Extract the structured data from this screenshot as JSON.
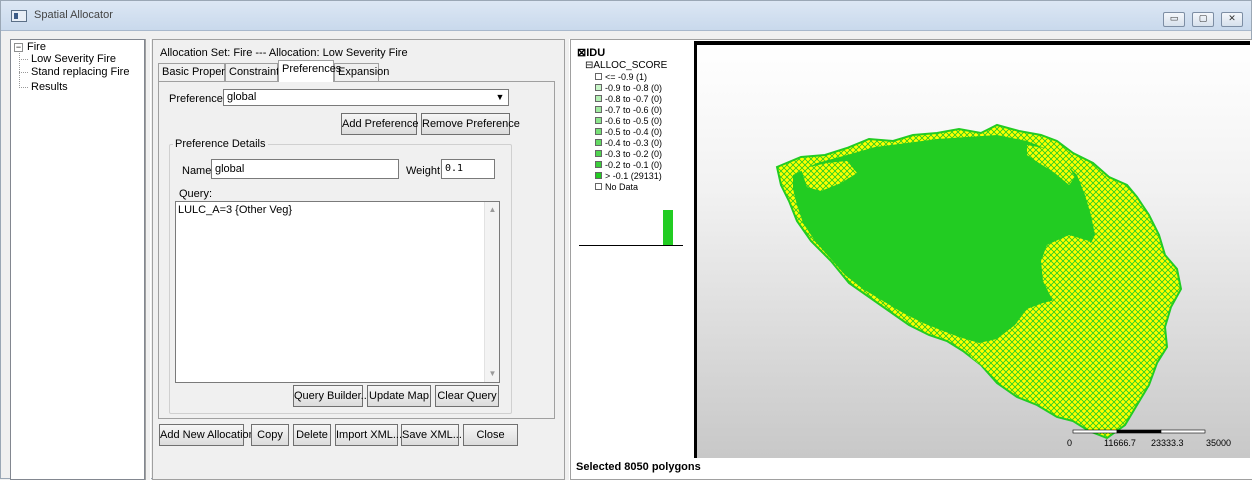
{
  "window": {
    "title": "Spatial Allocator",
    "controls": {
      "minimize": "▭",
      "maximize": "▢",
      "close": "✕"
    }
  },
  "tree": {
    "root": "Fire",
    "children": [
      "Low Severity Fire",
      "Stand replacing Fire",
      "Results"
    ]
  },
  "allocation": {
    "header": "Allocation Set: Fire --- Allocation: Low Severity Fire",
    "tabs": [
      "Basic Properties",
      "Constraints",
      "Preferences",
      "Expansion"
    ],
    "active_tab": "Preferences",
    "preferences_label": "Preferences:",
    "preferences_value": "global",
    "add_preference": "Add Preference",
    "remove_preference": "Remove Preference",
    "details_caption": "Preference Details",
    "name_label": "Name:",
    "name_value": "global",
    "weight_label": "Weight:",
    "weight_value": "0.1",
    "query_label": "Query:",
    "query_value": "LULC_A=3 {Other Veg}",
    "query_builder": "Query Builder...",
    "update_map": "Update Map",
    "clear_query": "Clear Query"
  },
  "bottom_buttons": {
    "add_new_allocation": "Add New Allocation",
    "copy": "Copy",
    "delete": "Delete",
    "import_xml": "Import XML...",
    "save_xml": "Save XML...",
    "close": "Close"
  },
  "legend": {
    "layer": "IDU",
    "field": "ALLOC_SCORE",
    "items": [
      {
        "label": "<= -0.9 (1)",
        "color": "#ffffff"
      },
      {
        "label": "-0.9 to -0.8 (0)",
        "color": "#c8f5c8"
      },
      {
        "label": "-0.8 to -0.7 (0)",
        "color": "#b4f0b4"
      },
      {
        "label": "-0.7 to -0.6 (0)",
        "color": "#a0eba0"
      },
      {
        "label": "-0.6 to -0.5 (0)",
        "color": "#8ce68c"
      },
      {
        "label": "-0.5 to -0.4 (0)",
        "color": "#78e078"
      },
      {
        "label": "-0.4 to -0.3 (0)",
        "color": "#64da64"
      },
      {
        "label": "-0.3 to -0.2 (0)",
        "color": "#50d450"
      },
      {
        "label": "-0.2 to -0.1 (0)",
        "color": "#3cce3c"
      },
      {
        "label": "> -0.1 (29131)",
        "color": "#22cc22"
      },
      {
        "label": "No Data",
        "color": "#ffffff"
      }
    ]
  },
  "map": {
    "fill_color": "#22cc22",
    "highlight_color": "#ffff00",
    "scale_labels": [
      "0",
      "11666.7",
      "23333.3",
      "35000"
    ]
  },
  "status": {
    "text": "Selected 8050 polygons"
  }
}
